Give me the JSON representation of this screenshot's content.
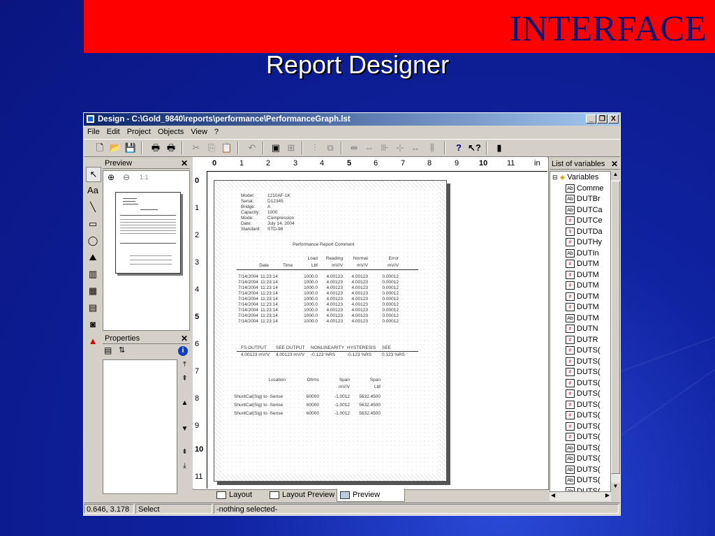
{
  "slide": {
    "banner": "INTERFACE",
    "subtitle": "Report Designer"
  },
  "window": {
    "title": "Design - C:\\Gold_9840\\reports\\performance\\PerformanceGraph.lst",
    "buttons": [
      "_",
      "❐",
      "X"
    ]
  },
  "menu": [
    "File",
    "Edit",
    "Project",
    "Objects",
    "View",
    "?"
  ],
  "toolbar_icons": [
    "new-icon",
    "open-icon",
    "save-icon",
    "print-icon",
    "print-preview-icon",
    "cut-icon",
    "copy-icon",
    "paste-icon",
    "undo-icon",
    "layer-icon",
    "properties-icon",
    "align-icon",
    "group-icon",
    "size-icon",
    "space-icon",
    "distribute-icon",
    "center-icon",
    "fit-icon",
    "help-icon",
    "context-help-icon",
    "exit-icon"
  ],
  "preview_panel": {
    "title": "Preview",
    "zoom_label": "1:1"
  },
  "properties_panel": {
    "title": "Properties"
  },
  "ruler": {
    "unit": "in",
    "h_labels": [
      "0",
      "1",
      "2",
      "3",
      "4",
      "5",
      "6",
      "7",
      "8",
      "9",
      "10",
      "11"
    ],
    "v_labels": [
      "0",
      "1",
      "2",
      "3",
      "4",
      "5",
      "6",
      "7",
      "8",
      "9",
      "10",
      "11"
    ]
  },
  "report": {
    "info_labels": [
      "Model:",
      "Serial:",
      "Bridge:",
      "Capacity:",
      "Mode:",
      "Date:",
      "Standard:"
    ],
    "info_values": [
      "1210AF-1K",
      "D12345",
      "A",
      "1000",
      "Compression",
      "July 14, 2004",
      "STD-98"
    ],
    "title": "Performance Report Comment",
    "headers_top": [
      "",
      "",
      "Load",
      "Reading",
      "Normal",
      "Error"
    ],
    "headers_bottom": [
      "Date",
      "Time",
      "Lbf",
      "mV/V",
      "mV/V",
      "mV/V"
    ],
    "rows": [
      [
        "7/14/2004",
        "11:23:14",
        "1000.0",
        "4.00123",
        "4.00123",
        "0.00012"
      ],
      [
        "7/14/2004",
        "11:23:14",
        "1000.0",
        "4.00123",
        "4.00123",
        "0.00012"
      ],
      [
        "7/14/2004",
        "11:23:14",
        "1000.0",
        "4.00123",
        "4.00123",
        "0.00012"
      ],
      [
        "7/14/2004",
        "11:23:14",
        "1000.0",
        "4.00123",
        "4.00123",
        "0.00012"
      ],
      [
        "7/14/2004",
        "11:23:14",
        "1000.0",
        "4.00123",
        "4.00123",
        "0.00012"
      ],
      [
        "7/14/2004",
        "11:23:14",
        "1000.0",
        "4.00123",
        "4.00123",
        "0.00012"
      ],
      [
        "7/14/2004",
        "11:23:14",
        "1000.0",
        "4.00123",
        "4.00123",
        "0.00012"
      ],
      [
        "7/14/2004",
        "11:23:14",
        "1000.0",
        "4.00123",
        "4.00123",
        "0.00012"
      ],
      [
        "7/14/2004",
        "11:23:14",
        "1000.0",
        "4.00123",
        "4.00123",
        "0.00012"
      ]
    ],
    "summary_headers": [
      "FS OUTPUT",
      "SEE OUTPUT",
      "NONLINEARITY",
      "HYSTERESIS",
      "SEE"
    ],
    "summary_values": [
      "4.00123 mV/V",
      "4.00123 mV/V",
      "-0.123 %RS",
      "-0.123 %RS",
      "0.123 %RS"
    ],
    "shunt_headers_top": [
      "Location",
      "Ohms",
      "Span",
      "Span"
    ],
    "shunt_headers_bottom": [
      "",
      "",
      "mV/V",
      "Lbf"
    ],
    "shunt_rows": [
      [
        "ShuntCal(Sig) to -Sense",
        "60000",
        "-1.0012",
        "5632.4500"
      ],
      [
        "ShuntCal(Sig) to -Sense",
        "60000",
        "-1.0012",
        "5632.4500"
      ],
      [
        "ShuntCal(Sig) to -Sense",
        "60000",
        "-1.0012",
        "5632.4500"
      ]
    ]
  },
  "tabs": [
    "Layout",
    "Layout Preview",
    "Preview"
  ],
  "variables_panel": {
    "title": "List of variables",
    "root": "Variables",
    "items": [
      {
        "label": "Comme",
        "type": "ab"
      },
      {
        "label": "DUTBr",
        "type": "ab"
      },
      {
        "label": "DUTCa",
        "type": "ab"
      },
      {
        "label": "DUTCe",
        "type": "num"
      },
      {
        "label": "DUTDa",
        "type": "date"
      },
      {
        "label": "DUTHy",
        "type": "num"
      },
      {
        "label": "DUTIn",
        "type": "ab"
      },
      {
        "label": "DUTM",
        "type": "num"
      },
      {
        "label": "DUTM",
        "type": "num"
      },
      {
        "label": "DUTM",
        "type": "num"
      },
      {
        "label": "DUTM",
        "type": "num"
      },
      {
        "label": "DUTM",
        "type": "num"
      },
      {
        "label": "DUTM",
        "type": "ab"
      },
      {
        "label": "DUTN",
        "type": "num"
      },
      {
        "label": "DUTR",
        "type": "num"
      },
      {
        "label": "DUTS(",
        "type": "num"
      },
      {
        "label": "DUTS(",
        "type": "num"
      },
      {
        "label": "DUTS(",
        "type": "num"
      },
      {
        "label": "DUTS(",
        "type": "num"
      },
      {
        "label": "DUTS(",
        "type": "num"
      },
      {
        "label": "DUTS(",
        "type": "num"
      },
      {
        "label": "DUTS(",
        "type": "num"
      },
      {
        "label": "DUTS(",
        "type": "num"
      },
      {
        "label": "DUTS(",
        "type": "num"
      },
      {
        "label": "DUTS(",
        "type": "ab"
      },
      {
        "label": "DUTS(",
        "type": "ab"
      },
      {
        "label": "DUTS(",
        "type": "ab"
      },
      {
        "label": "DUTS(",
        "type": "ab"
      },
      {
        "label": "DUTS(",
        "type": "ab"
      }
    ]
  },
  "status": {
    "coords": "0.646, 3.178",
    "mode": "Select",
    "selection": "-nothing selected-"
  }
}
